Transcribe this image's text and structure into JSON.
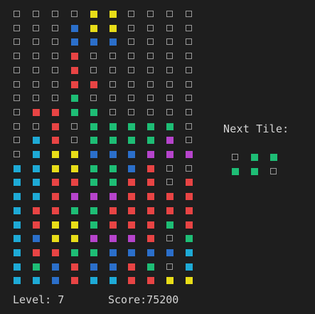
{
  "colors": {
    "yellow": "#e8dd18",
    "blue": "#2b6fca",
    "red": "#e84444",
    "green": "#1ebd75",
    "cyan": "#1eaad6",
    "magenta": "#b644cc",
    "empty_border": "#9a9a9a",
    "background": "#1e1e1e",
    "text": "#d4d4d4"
  },
  "board": {
    "columns": 10,
    "rows": 20,
    "cells": [
      "....YY....",
      "...BYY....",
      "...BBB....",
      "...R......",
      "...R......",
      "...RR.....",
      "...G......",
      ".RRGG.....",
      "..R.GGGGG.",
      ".CR.GGGGM.",
      ".CYYBBBMMM",
      "CCYYGGBR..",
      "CCRRGGRR.R",
      "CCRMMMRRRR",
      "CRRGGRRRRR",
      "CRYYGRRRGR",
      "CBYYMMMR.G",
      "CRRGGBBBBC",
      "CGBRBBRG.C",
      "CCBRCCRRYY"
    ]
  },
  "next_tile": {
    "label": "Next Tile:",
    "columns": 3,
    "rows": 2,
    "cells": [
      ".GG",
      "GG."
    ]
  },
  "status": {
    "level_text": "Level: 7",
    "score_text": "Score:75200"
  }
}
